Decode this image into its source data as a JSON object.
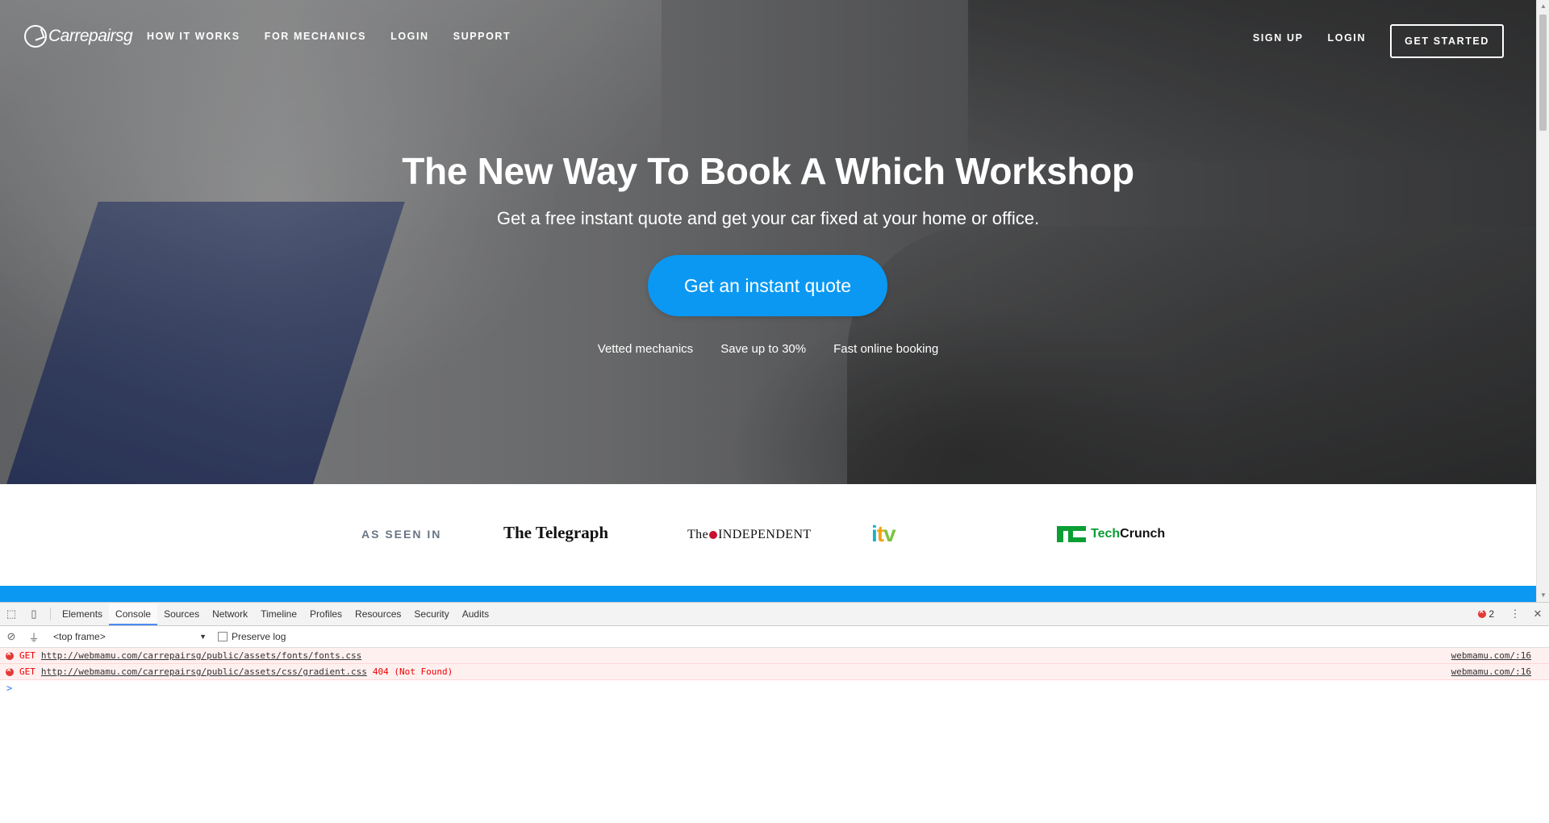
{
  "brand": {
    "logo_text": "Carrepairsg"
  },
  "nav": {
    "left_links": [
      "HOW IT WORKS",
      "FOR MECHANICS",
      "LOGIN",
      "SUPPORT"
    ],
    "signup": "SIGN UP",
    "login": "LOGIN",
    "get_started": "GET STARTED"
  },
  "hero": {
    "headline": "The New Way To Book A Which Workshop",
    "subhead": "Get a free instant quote and get your car fixed at your home or office.",
    "cta": "Get an instant quote",
    "features": [
      "Vetted mechanics",
      "Save up to 30%",
      "Fast online booking"
    ]
  },
  "press": {
    "label": "AS SEEN IN",
    "telegraph": "The Telegraph",
    "independent_left": "The",
    "independent_right": "INDEPENDENT",
    "itv": {
      "i": "i",
      "t": "t",
      "v": "v"
    },
    "techcrunch_tech": "Tech",
    "techcrunch_crunch": "Crunch"
  },
  "devtools": {
    "tabs": [
      "Elements",
      "Console",
      "Sources",
      "Network",
      "Timeline",
      "Profiles",
      "Resources",
      "Security",
      "Audits"
    ],
    "active_tab": "Console",
    "error_count": "2",
    "frame": "<top frame>",
    "preserve_log": "Preserve log",
    "logs": [
      {
        "method": "GET",
        "url": "http://webmamu.com/carrepairsg/public/assets/fonts/fonts.css",
        "status": "",
        "source": "webmamu.com/:16"
      },
      {
        "method": "GET",
        "url": "http://webmamu.com/carrepairsg/public/assets/css/gradient.css",
        "status": "404 (Not Found)",
        "source": "webmamu.com/:16"
      }
    ],
    "prompt": ">"
  },
  "colors": {
    "accent": "#0a98f2",
    "error": "#e53935"
  }
}
